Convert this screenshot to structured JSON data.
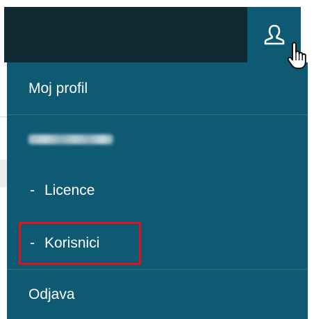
{
  "header": {
    "user_icon": "user-icon",
    "cursor_icon": "hand-pointer-icon"
  },
  "menu": {
    "profile_label": "Moj profil",
    "account_icon": "blurred-account-name",
    "licenses_dash": "-",
    "licenses_label": "Licence",
    "users_dash": "-",
    "users_label": "Korisnici",
    "logout_label": "Odjava"
  },
  "colors": {
    "topbar": "#0f2a33",
    "menu_bg": "#0e5a73",
    "divider": "#2e7489",
    "highlight": "#e0141c",
    "text": "#ffffff"
  }
}
